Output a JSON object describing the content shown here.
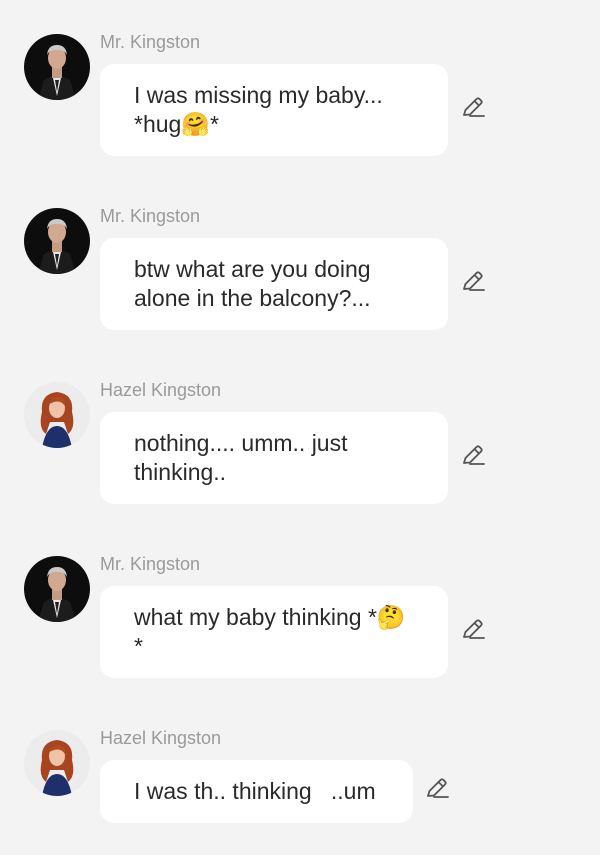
{
  "colors": {
    "background": "#f3f3f3",
    "bubble": "#ffffff",
    "name_text": "#9a9a9a",
    "message_text": "#2a2a2a",
    "icon": "#555555"
  },
  "messages": [
    {
      "sender": "Mr. Kingston",
      "avatar": "man-in-suit",
      "text": "I was missing my baby... *hug🤗*",
      "action_icon": "pencil-edit-icon"
    },
    {
      "sender": "Mr. Kingston",
      "avatar": "man-in-suit",
      "text": "btw what are you doing alone in the balcony?...",
      "action_icon": "pencil-edit-icon"
    },
    {
      "sender": "Hazel Kingston",
      "avatar": "red-haired-woman",
      "text": "nothing.... umm.. just thinking..",
      "action_icon": "pencil-edit-icon"
    },
    {
      "sender": "Mr. Kingston",
      "avatar": "man-in-suit",
      "text": "what my baby thinking *🤔*",
      "action_icon": "pencil-edit-icon"
    },
    {
      "sender": "Hazel Kingston",
      "avatar": "red-haired-woman",
      "text": "I was th.. thinking   ..um",
      "action_icon": "pencil-edit-icon"
    }
  ]
}
